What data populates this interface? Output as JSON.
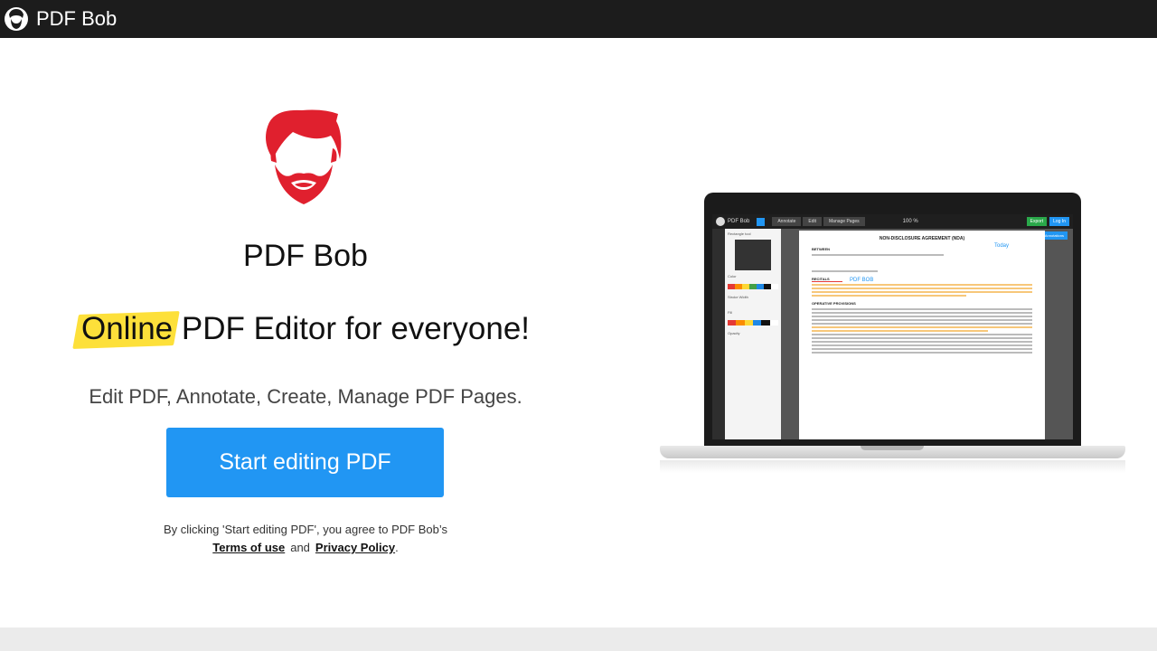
{
  "header": {
    "brand_name": "PDF Bob",
    "logo_icon": "bearded-man-icon"
  },
  "hero": {
    "logo_icon": "bearded-man-icon",
    "logo_color": "#e0202e",
    "title": "PDF Bob",
    "headline_highlight": "Online",
    "headline_rest": " PDF Editor for everyone!",
    "highlight_color": "#fde03a",
    "subline": "Edit PDF, Annotate, Create, Manage PDF Pages.",
    "cta_label": "Start editing PDF",
    "cta_color": "#2196f3",
    "consent_text": "By clicking 'Start editing PDF', you agree to PDF Bob’s",
    "terms_label": "Terms of use",
    "and_label": "and",
    "privacy_label": "Privacy Policy",
    "trailing_period": "."
  },
  "preview": {
    "app_name": "PDF Bob",
    "tabs": [
      "Annotate",
      "Edit",
      "Manage Pages"
    ],
    "zoom": "100 %",
    "export_label": "Export",
    "login_label": "Log In",
    "annotations_label": "Annotations",
    "panel_title": "Rectangle tool",
    "panel_color_label": "Color",
    "panel_stroke_label": "Stroke Width",
    "panel_fill_label": "Fill",
    "panel_opacity_label": "Opacity",
    "doc_title": "NON-DISCLOSURE AGREEMENT (NDA)",
    "doc_today": "Today",
    "doc_signer": "PDF BOB",
    "doc_between": "BETWEEN",
    "doc_recitals": "RECITALS",
    "doc_operative": "OPERATIVE PROVISIONS"
  }
}
